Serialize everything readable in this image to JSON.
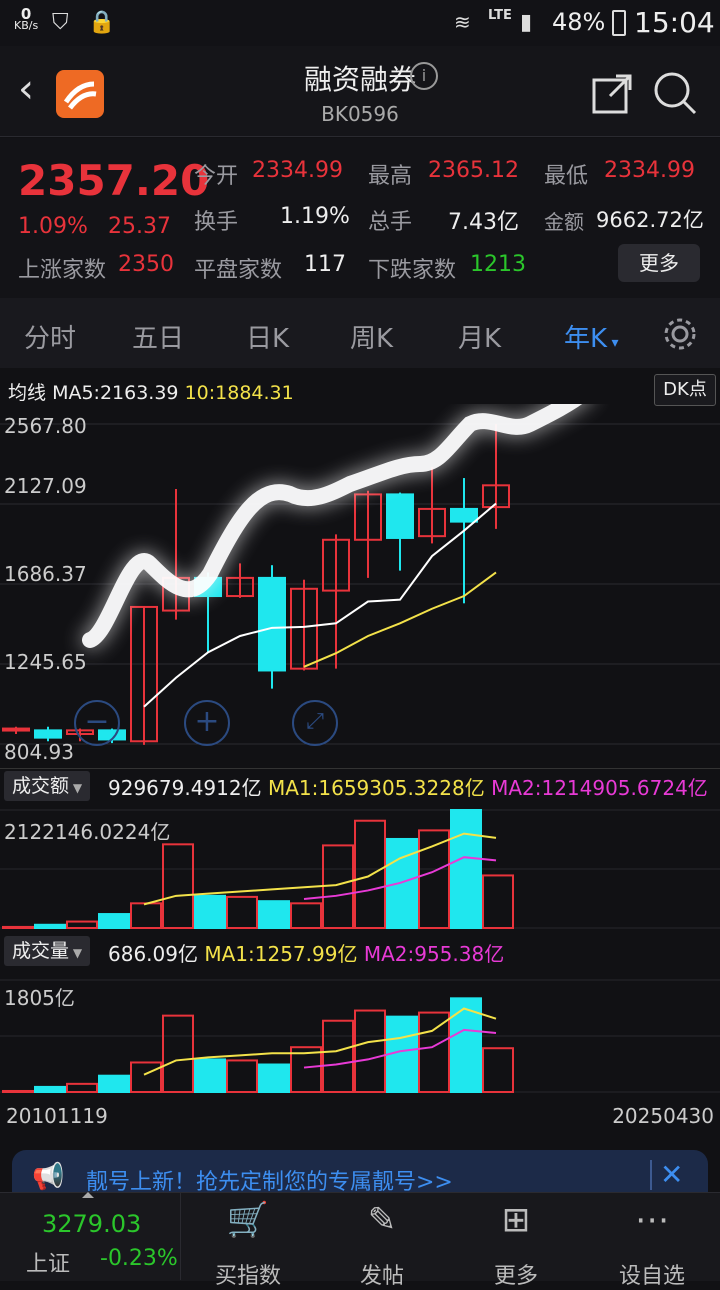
{
  "status": {
    "speed_value": "0",
    "speed_unit": "KB/s",
    "network": "LTE",
    "battery": "48%",
    "time": "15:04"
  },
  "header": {
    "title": "融资融券",
    "code": "BK0596"
  },
  "quote": {
    "price": "2357.20",
    "change_pct": "1.09%",
    "change": "25.37",
    "open_label": "今开",
    "open": "2334.99",
    "high_label": "最高",
    "high": "2365.12",
    "low_label": "最低",
    "low": "2334.99",
    "turnover_rate_label": "换手",
    "turnover_rate": "1.19%",
    "volume_label": "总手",
    "volume": "7.43亿",
    "amount_label": "金额",
    "amount": "9662.72亿",
    "up_label": "上涨家数",
    "up": "2350",
    "flat_label": "平盘家数",
    "flat": "117",
    "down_label": "下跌家数",
    "down": "1213",
    "more_label": "更多"
  },
  "tabs": [
    "分时",
    "五日",
    "日K",
    "周K",
    "月K",
    "年K"
  ],
  "indicators": {
    "ma_label": "均线",
    "ma5": "MA5:2163.39",
    "ma10": "10:1884.31",
    "dk_label": "DK点",
    "amount_btn": "成交额",
    "amount_value": "929679.4912亿",
    "amount_ma1": "MA1:1659305.3228亿",
    "amount_ma2": "MA2:1214905.6724亿",
    "amount_axis_max": "2122146.0224亿",
    "volume_btn": "成交量",
    "volume_value": "686.09亿",
    "volume_ma1": "MA1:1257.99亿",
    "volume_ma2": "MA2:955.38亿",
    "volume_axis_max": "1805亿",
    "date_start": "20101119",
    "date_end": "20250430"
  },
  "chart_data": {
    "type": "candlestick",
    "y_ticks": [
      "2567.80",
      "2127.09",
      "1686.37",
      "1245.65",
      "804.93"
    ],
    "ylim": [
      804.93,
      2567.8
    ],
    "candles": [
      {
        "o": 880,
        "c": 890,
        "h": 900,
        "l": 860
      },
      {
        "o": 880,
        "c": 840,
        "h": 900,
        "l": 820
      },
      {
        "o": 860,
        "c": 880,
        "h": 890,
        "l": 820
      },
      {
        "o": 880,
        "c": 830,
        "h": 890,
        "l": 810
      },
      {
        "o": 820,
        "c": 1560,
        "h": 1560,
        "l": 800
      },
      {
        "o": 1540,
        "c": 1720,
        "h": 2210,
        "l": 1490
      },
      {
        "o": 1720,
        "c": 1620,
        "h": 1750,
        "l": 1310
      },
      {
        "o": 1620,
        "c": 1720,
        "h": 1800,
        "l": 1610
      },
      {
        "o": 1720,
        "c": 1210,
        "h": 1790,
        "l": 1110
      },
      {
        "o": 1220,
        "c": 1660,
        "h": 1710,
        "l": 1210
      },
      {
        "o": 1650,
        "c": 1930,
        "h": 1960,
        "l": 1220
      },
      {
        "o": 1930,
        "c": 2180,
        "h": 2200,
        "l": 1720
      },
      {
        "o": 2180,
        "c": 1940,
        "h": 2190,
        "l": 1760
      },
      {
        "o": 1950,
        "c": 2100,
        "h": 2330,
        "l": 1910
      },
      {
        "o": 2100,
        "c": 2030,
        "h": 2270,
        "l": 1580
      },
      {
        "o": 2110,
        "c": 2230,
        "h": 2567,
        "l": 1990
      }
    ],
    "ma5": [
      null,
      null,
      null,
      null,
      1010,
      1170,
      1310,
      1400,
      1445,
      1450,
      1470,
      1590,
      1600,
      1840,
      1980,
      2130
    ],
    "ma10": [
      null,
      null,
      null,
      null,
      null,
      null,
      null,
      null,
      null,
      1230,
      1305,
      1400,
      1470,
      1550,
      1620,
      1750
    ],
    "amount": [
      0.01,
      0.03,
      0.06,
      0.13,
      0.23,
      0.78,
      0.3,
      0.29,
      0.25,
      0.23,
      0.77,
      1.0,
      0.83,
      0.91,
      1.1,
      0.49
    ],
    "amount_ma1": [
      null,
      null,
      null,
      null,
      0.22,
      0.3,
      0.32,
      0.34,
      0.36,
      0.38,
      0.4,
      0.48,
      0.65,
      0.76,
      0.88,
      0.84
    ],
    "amount_ma2": [
      null,
      null,
      null,
      null,
      null,
      null,
      null,
      null,
      null,
      0.27,
      0.3,
      0.35,
      0.42,
      0.52,
      0.66,
      0.63
    ],
    "volume": [
      0.01,
      0.05,
      0.08,
      0.16,
      0.29,
      0.75,
      0.32,
      0.31,
      0.27,
      0.44,
      0.7,
      0.8,
      0.74,
      0.78,
      0.92,
      0.43
    ],
    "volume_ma1": [
      null,
      null,
      null,
      null,
      0.17,
      0.31,
      0.34,
      0.36,
      0.38,
      0.38,
      0.4,
      0.49,
      0.53,
      0.6,
      0.82,
      0.72
    ],
    "volume_ma2": [
      null,
      null,
      null,
      null,
      null,
      null,
      null,
      null,
      null,
      0.24,
      0.27,
      0.32,
      0.4,
      0.44,
      0.61,
      0.58
    ]
  },
  "banner": {
    "text": "靓号上新！抢先定制您的专属靓号>>"
  },
  "bottom": {
    "index_value": "3279.03",
    "index_name": "上证",
    "index_change": "-0.23%",
    "nav": [
      "买指数",
      "发帖",
      "更多",
      "设自选"
    ]
  },
  "colors": {
    "up": "#e8333b",
    "down": "#1fe7ee",
    "ma5": "#ffffff",
    "ma10": "#f3e24a",
    "ma2": "#e83ad6"
  }
}
